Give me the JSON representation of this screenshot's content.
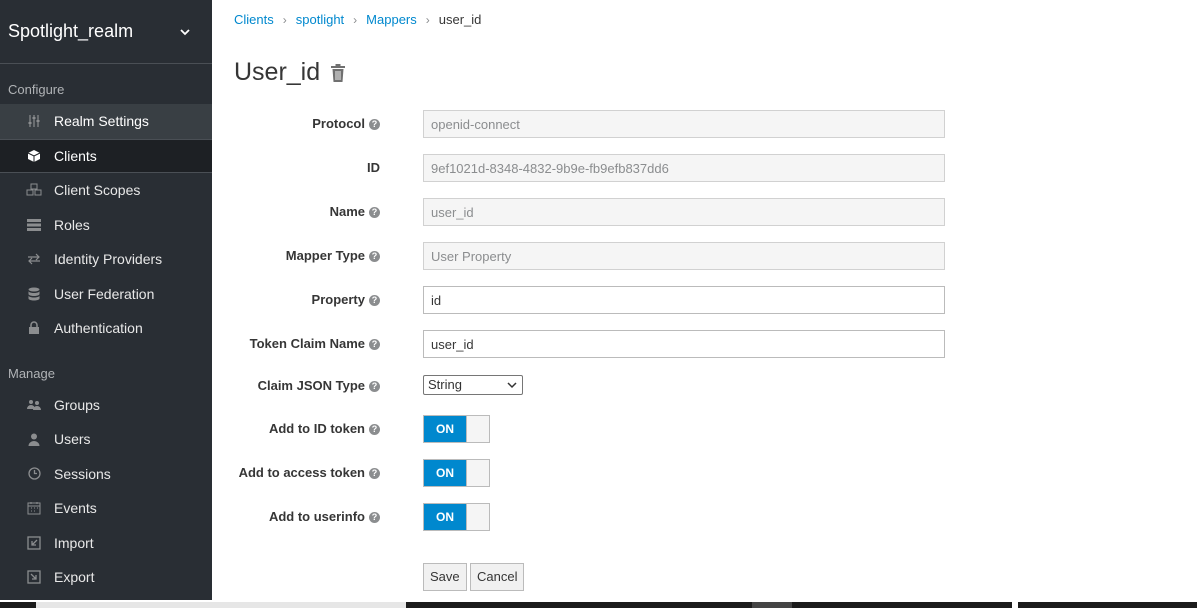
{
  "sidebar": {
    "realm": "Spotlight_realm",
    "configure_label": "Configure",
    "manage_label": "Manage",
    "configure_items": [
      {
        "label": "Realm Settings"
      },
      {
        "label": "Clients"
      },
      {
        "label": "Client Scopes"
      },
      {
        "label": "Roles"
      },
      {
        "label": "Identity Providers"
      },
      {
        "label": "User Federation"
      },
      {
        "label": "Authentication"
      }
    ],
    "manage_items": [
      {
        "label": "Groups"
      },
      {
        "label": "Users"
      },
      {
        "label": "Sessions"
      },
      {
        "label": "Events"
      },
      {
        "label": "Import"
      },
      {
        "label": "Export"
      }
    ]
  },
  "breadcrumb": [
    "Clients",
    "spotlight",
    "Mappers",
    "user_id"
  ],
  "page": {
    "title": "User_id"
  },
  "form": {
    "protocol": {
      "label": "Protocol",
      "value": "openid-connect"
    },
    "id": {
      "label": "ID",
      "value": "9ef1021d-8348-4832-9b9e-fb9efb837dd6"
    },
    "name": {
      "label": "Name",
      "value": "user_id"
    },
    "mapper_type": {
      "label": "Mapper Type",
      "value": "User Property"
    },
    "property": {
      "label": "Property",
      "value": "id"
    },
    "token_claim": {
      "label": "Token Claim Name",
      "value": "user_id"
    },
    "claim_json": {
      "label": "Claim JSON Type",
      "value": "String"
    },
    "add_id_token": {
      "label": "Add to ID token",
      "state": "ON"
    },
    "add_access_token": {
      "label": "Add to access token",
      "state": "ON"
    },
    "add_userinfo": {
      "label": "Add to userinfo",
      "state": "ON"
    }
  },
  "buttons": {
    "save": "Save",
    "cancel": "Cancel"
  },
  "colors": {
    "sidebar_bg": "#292e34",
    "accent": "#0088ce"
  }
}
